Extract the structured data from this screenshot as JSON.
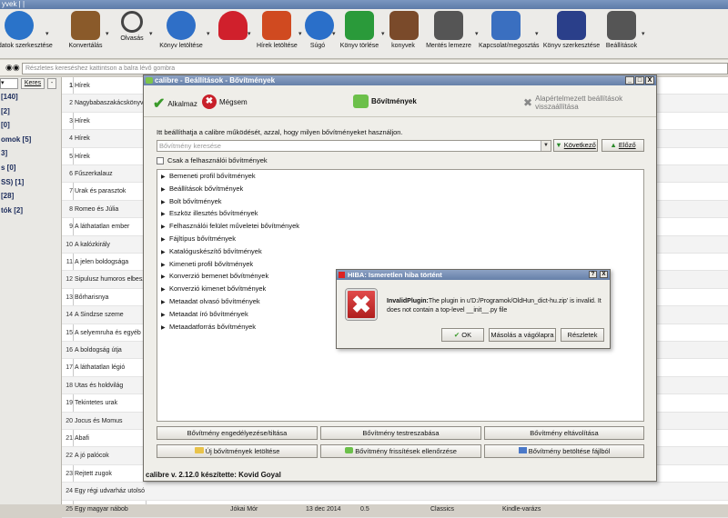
{
  "window": {
    "title": "yvek | |"
  },
  "toolbar": [
    {
      "label": "adatok szerkesztése",
      "icon": "info-icon",
      "color": "#2a73c9"
    },
    {
      "label": "Konvertálás",
      "icon": "convert-book-icon",
      "color": "#8a5a2a"
    },
    {
      "label": "Olvasás",
      "icon": "magnifier-icon",
      "color": "#444444"
    },
    {
      "label": "Könyv letöltése",
      "icon": "globe-icon",
      "color": "#2f6fc7"
    },
    {
      "label": "",
      "icon": "heart-icon",
      "color": "#d0202c"
    },
    {
      "label": "Hírek letöltése",
      "icon": "news-icon",
      "color": "#d04a20"
    },
    {
      "label": "Súgó",
      "icon": "help-icon",
      "color": "#2a6fc9"
    },
    {
      "label": "Könyv törlése",
      "icon": "recycle-icon",
      "color": "#2a9a3a"
    },
    {
      "label": "konyvek",
      "icon": "library-icon",
      "color": "#7a4a2a"
    },
    {
      "label": "Mentés lemezre",
      "icon": "device-icon",
      "color": "#555555"
    },
    {
      "label": "Kapcsolat/megosztás",
      "icon": "connect-icon",
      "color": "#3a6fc0"
    },
    {
      "label": "Könyv szerkesztése",
      "icon": "edit-book-icon",
      "color": "#2a3f8a"
    },
    {
      "label": "Beállítások",
      "icon": "gear-icon",
      "color": "#555555"
    }
  ],
  "search": {
    "placeholder": "Részletes kereséshez kattintson a balra lévő gombra"
  },
  "sidebar": {
    "keres_label": "Keres",
    "minus_label": "-",
    "items": [
      "[140]",
      "[2]",
      "[0]",
      "omok [5]",
      "3]",
      "s [0]",
      "SS) [1]",
      "[28]",
      "tók [2]"
    ]
  },
  "books": [
    {
      "n": "1",
      "title": "Hírek"
    },
    {
      "n": "2",
      "title": "Nagybabaszakácskönyv"
    },
    {
      "n": "3",
      "title": "Hírek"
    },
    {
      "n": "4",
      "title": "Hírek"
    },
    {
      "n": "5",
      "title": "Hírek"
    },
    {
      "n": "6",
      "title": "Fűszerkalauz"
    },
    {
      "n": "7",
      "title": "Urak és parasztok"
    },
    {
      "n": "8",
      "title": "Romeo és Júlia"
    },
    {
      "n": "9",
      "title": "A láthatatlan ember"
    },
    {
      "n": "10",
      "title": "A kalózkirály"
    },
    {
      "n": "11",
      "title": "A jelen boldogsága"
    },
    {
      "n": "12",
      "title": "Sipulusz humoros elbeszél"
    },
    {
      "n": "13",
      "title": "Bőrharisnya"
    },
    {
      "n": "14",
      "title": "A Sindzse szeme"
    },
    {
      "n": "15",
      "title": "A selyemruha és egyéb el"
    },
    {
      "n": "16",
      "title": "A boldogság útja"
    },
    {
      "n": "17",
      "title": "A láthatatlan légió"
    },
    {
      "n": "18",
      "title": "Utas és holdvilág"
    },
    {
      "n": "19",
      "title": "Tekintetes urak"
    },
    {
      "n": "20",
      "title": "Jocus és Momus"
    },
    {
      "n": "21",
      "title": "Abafi"
    },
    {
      "n": "22",
      "title": "A jó palócok"
    },
    {
      "n": "23",
      "title": "Rejtett zugok"
    },
    {
      "n": "24",
      "title": "Egy régi udvarház utolsó"
    },
    {
      "n": "25",
      "title": "Egy magyar nábob",
      "author": "Jókai Mór",
      "date": "13 dec 2014",
      "size": "0.5",
      "tag": "Classics",
      "series": "Kindle-varázs"
    }
  ],
  "prefs": {
    "title": "calibre - Beállítások - Bővítmények",
    "apply_label": "Alkalmaz",
    "cancel_label": "Mégsem",
    "section_label": "Bővítmények",
    "restore_label": "Alapértelmezett beállítások visszaállítása",
    "intro": "Itt beállíthatja a calibre működését, azzal, hogy milyen bővítményeket használjon.",
    "filter_placeholder": "Bővítmény keresése",
    "next_label": "Következő",
    "prev_label": "Előző",
    "only_user_label": "Csak a felhasználói bővítmények",
    "plugin_groups": [
      "Bemeneti profil bővítmények",
      "Beállítások bővítmények",
      "Bolt bővítmények",
      "Eszköz illesztés bővítmények",
      "Felhasználói felület műveletei bővítmények",
      "Fájltípus bővítmények",
      "Katalóguskészítő bővítmények",
      "Kimeneti profil bővítmények",
      "Konverzió bemenet bővítmények",
      "Konverzió kimenet bővítmények",
      "Metaadat olvasó bővítmények",
      "Metaadat író bővítmények",
      "Metaadatforrás bővítmények"
    ],
    "enable_toggle_label": "Bővítmény engedélyezése/tiltása",
    "customize_label": "Bővítmény testreszabása",
    "remove_label": "Bővítmény eltávolítása",
    "get_new_label": "Új bővítmények letöltése",
    "check_updates_label": "Bővítmény frissítések ellenőrzése",
    "load_file_label": "Bővítmény betöltése fájlból",
    "footer": "calibre v. 2.12.0 készítette: Kovid Goyal"
  },
  "error": {
    "title": "HIBA: Ismeretlen hiba történt",
    "help": "?",
    "close": "X",
    "message_bold": "InvalidPlugin:",
    "message": "The plugin in u'D:/Programok/OldHun_dict-hu.zip' is invalid. It does not contain a top-level __init__.py file",
    "ok_label": "OK",
    "copy_label": "Másolás a vágólapra",
    "details_label": "Részletek"
  }
}
